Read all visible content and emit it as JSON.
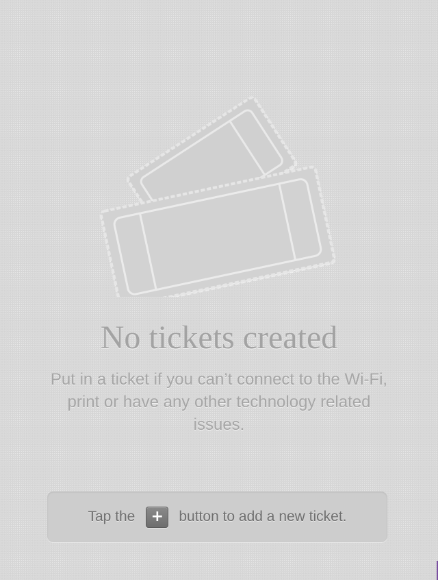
{
  "empty_state": {
    "illustration_icon": "tickets-icon",
    "title": "No tickets created",
    "description": "Put in a ticket if you can’t connect to the Wi-Fi, print or have any other technology related issues.",
    "hint": {
      "prefix": "Tap the",
      "button_label": "+",
      "button_icon": "plus-icon",
      "suffix": "button to add a new ticket."
    }
  },
  "colors": {
    "background": "#d8d8d8",
    "text_muted": "#a3a3a3",
    "hint_box": "#cdcdcd",
    "hint_text": "#6f6f6f",
    "button": "#7a7a7a"
  }
}
